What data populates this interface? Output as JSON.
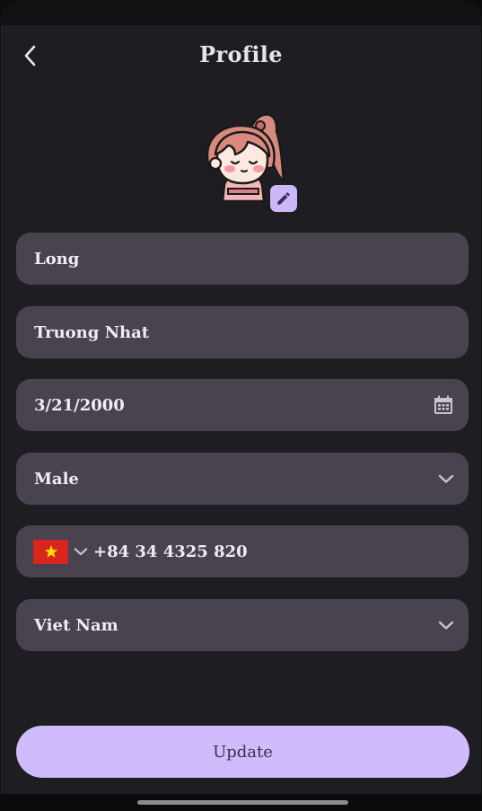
{
  "header": {
    "title": "Profile",
    "back_icon": "chevron-left-icon"
  },
  "avatar": {
    "icon": "girl-avatar-icon",
    "edit_icon": "pencil-icon",
    "badge_color": "#cdb7fb"
  },
  "form": {
    "first_name": "Long",
    "last_name": "Truong Nhat",
    "birthday": "3/21/2000",
    "birthday_icon": "calendar-icon",
    "gender": "Male",
    "phone": {
      "country_flag": "vietnam-flag-icon",
      "number": "+84 34 4325 820"
    },
    "country": "Viet Nam"
  },
  "actions": {
    "update_label": "Update"
  },
  "colors": {
    "background": "#1e1d21",
    "field": "#49424f",
    "accent": "#d0bcfd",
    "text": "#f0edf2"
  }
}
